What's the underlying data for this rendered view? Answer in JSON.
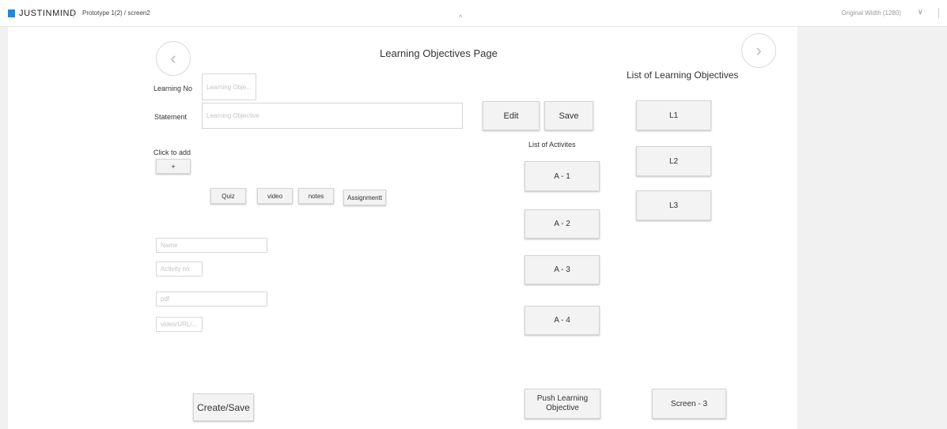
{
  "topbar": {
    "brand": "JUSTINMIND",
    "breadcrumb": "Prototype 1(2)  /  screen2",
    "collapse_glyph": "^",
    "width_select": "Original Width (1280)",
    "width_chevron": "∨"
  },
  "page": {
    "title": "Learning Objectives Page",
    "prev_glyph": "‹",
    "next_glyph": "›"
  },
  "form": {
    "learning_no_label": "Learning No",
    "learning_no_placeholder": "Learning Obje...",
    "statement_label": "Statement",
    "statement_placeholder": "Learning Objective",
    "click_to_add_label": "Click to add",
    "add_button": "+",
    "name_placeholder": "Name",
    "activity_no_placeholder": "Activity no",
    "pdf_placeholder": "pdf",
    "url_placeholder": "video/URL/..."
  },
  "activity_types": [
    "Quiz",
    "video",
    "notes",
    "Assignmentt"
  ],
  "actions": {
    "edit": "Edit",
    "save": "Save",
    "create_save": "Create/Save",
    "push": "Push Learning Objective",
    "screen3": "Screen - 3"
  },
  "activities": {
    "title": "List of Activites",
    "items": [
      "A - 1",
      "A - 2",
      "A - 3",
      "A - 4"
    ]
  },
  "objectives": {
    "title": "List of Learning Objectives",
    "items": [
      "L1",
      "L2",
      "L3"
    ]
  }
}
